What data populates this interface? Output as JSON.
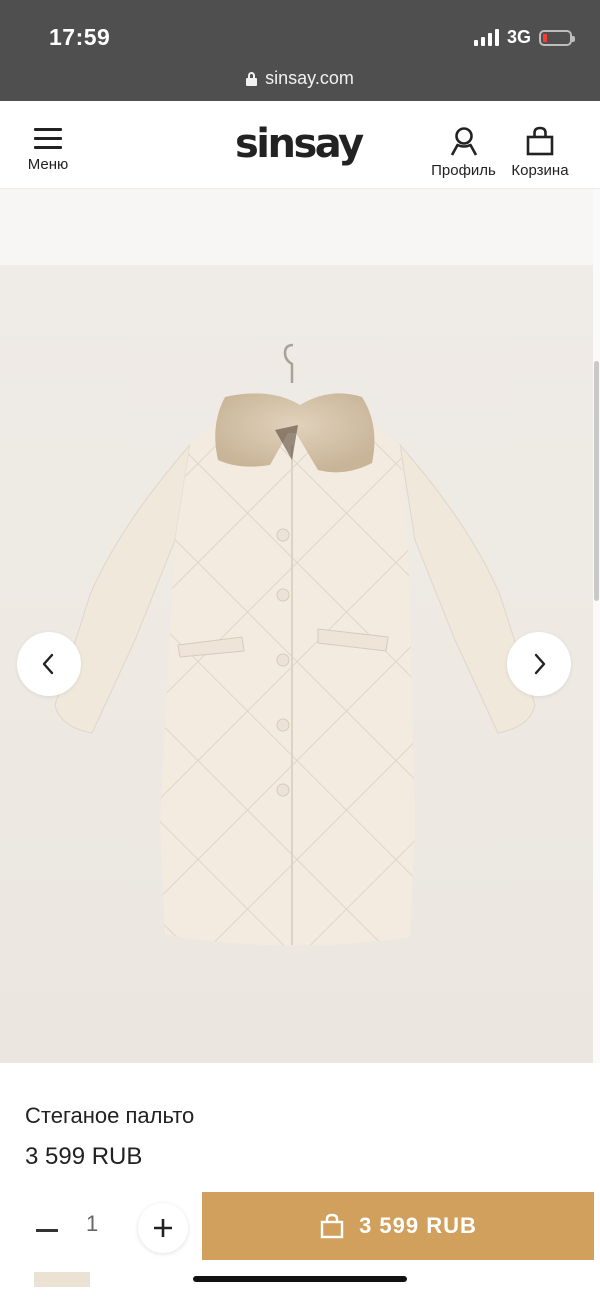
{
  "status_bar": {
    "time": "17:59",
    "network": "3G",
    "battery_color": "#ff3b30"
  },
  "browser": {
    "url": "sinsay.com",
    "lock_icon": "lock-icon"
  },
  "header": {
    "menu_label": "Меню",
    "logo": "sinsay",
    "profile_label": "Профиль",
    "cart_label": "Корзина"
  },
  "gallery": {
    "prev_icon": "chevron-left-icon",
    "next_icon": "chevron-right-icon"
  },
  "product": {
    "name": "Стеганое пальто",
    "price": "3 599 RUB",
    "quantity": "1",
    "add_to_cart_price": "3 599 RUB"
  },
  "colors": {
    "accent": "#d2a05d",
    "status_bar": "#4f4f4f",
    "coat": "#f1e8dc",
    "collar": "#d8c6ab"
  }
}
